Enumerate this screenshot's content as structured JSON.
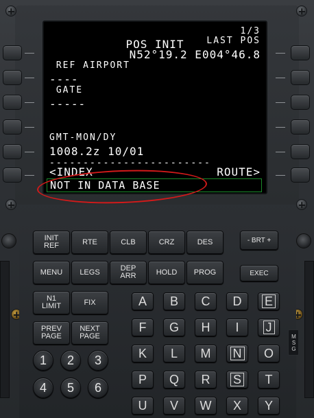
{
  "display": {
    "title": "POS INIT",
    "page": "1/3",
    "rows": [
      {
        "left": "",
        "right": "LAST POS",
        "small": true
      },
      {
        "left": "",
        "right": "N52°19.2 E004°46.8",
        "small": false
      },
      {
        "left": " REF AIRPORT",
        "right": "",
        "small": true
      },
      {
        "left": "----",
        "right": "",
        "small": false
      },
      {
        "left": " GATE",
        "right": "",
        "small": true
      },
      {
        "left": "-----",
        "right": "",
        "small": false
      },
      {
        "left": "",
        "right": "",
        "small": true
      },
      {
        "left": "",
        "right": "",
        "small": false
      },
      {
        "left": "GMT-MON/DY",
        "right": "",
        "small": true
      },
      {
        "left": "1008.2z 10/01",
        "right": "",
        "small": false
      },
      {
        "left": "------------------------",
        "right": "",
        "small": true
      },
      {
        "left": "<INDEX",
        "right": "ROUTE>",
        "small": false
      }
    ],
    "scratchpad": "NOT IN DATA BASE"
  },
  "function_keys": {
    "row1": [
      "INIT\nREF",
      "RTE",
      "CLB",
      "CRZ",
      "DES"
    ],
    "row2": [
      "MENU",
      "LEGS",
      "DEP\nARR",
      "HOLD",
      "PROG"
    ],
    "row3": [
      "N1\nLIMIT",
      "FIX"
    ],
    "row4": [
      "PREV\nPAGE",
      "NEXT\nPAGE"
    ]
  },
  "brt_label": "- BRT +",
  "exec_label": "EXEC",
  "msg_label": "MSG",
  "alpha_rows": [
    [
      "A",
      "B",
      "C",
      "D",
      "E"
    ],
    [
      "F",
      "G",
      "H",
      "I",
      "J"
    ],
    [
      "K",
      "L",
      "M",
      "N",
      "O"
    ],
    [
      "P",
      "Q",
      "R",
      "S",
      "T"
    ],
    [
      "U",
      "V",
      "W",
      "X",
      "Y"
    ]
  ],
  "outlined_alpha": [
    "E",
    "J",
    "N",
    "S"
  ],
  "number_rows": [
    [
      "1",
      "2",
      "3"
    ],
    [
      "4",
      "5",
      "6"
    ]
  ],
  "colors": {
    "screen_text": "#ffffff",
    "scratchpad_border": "#1a8a2a",
    "annotation": "#d31a1a"
  }
}
